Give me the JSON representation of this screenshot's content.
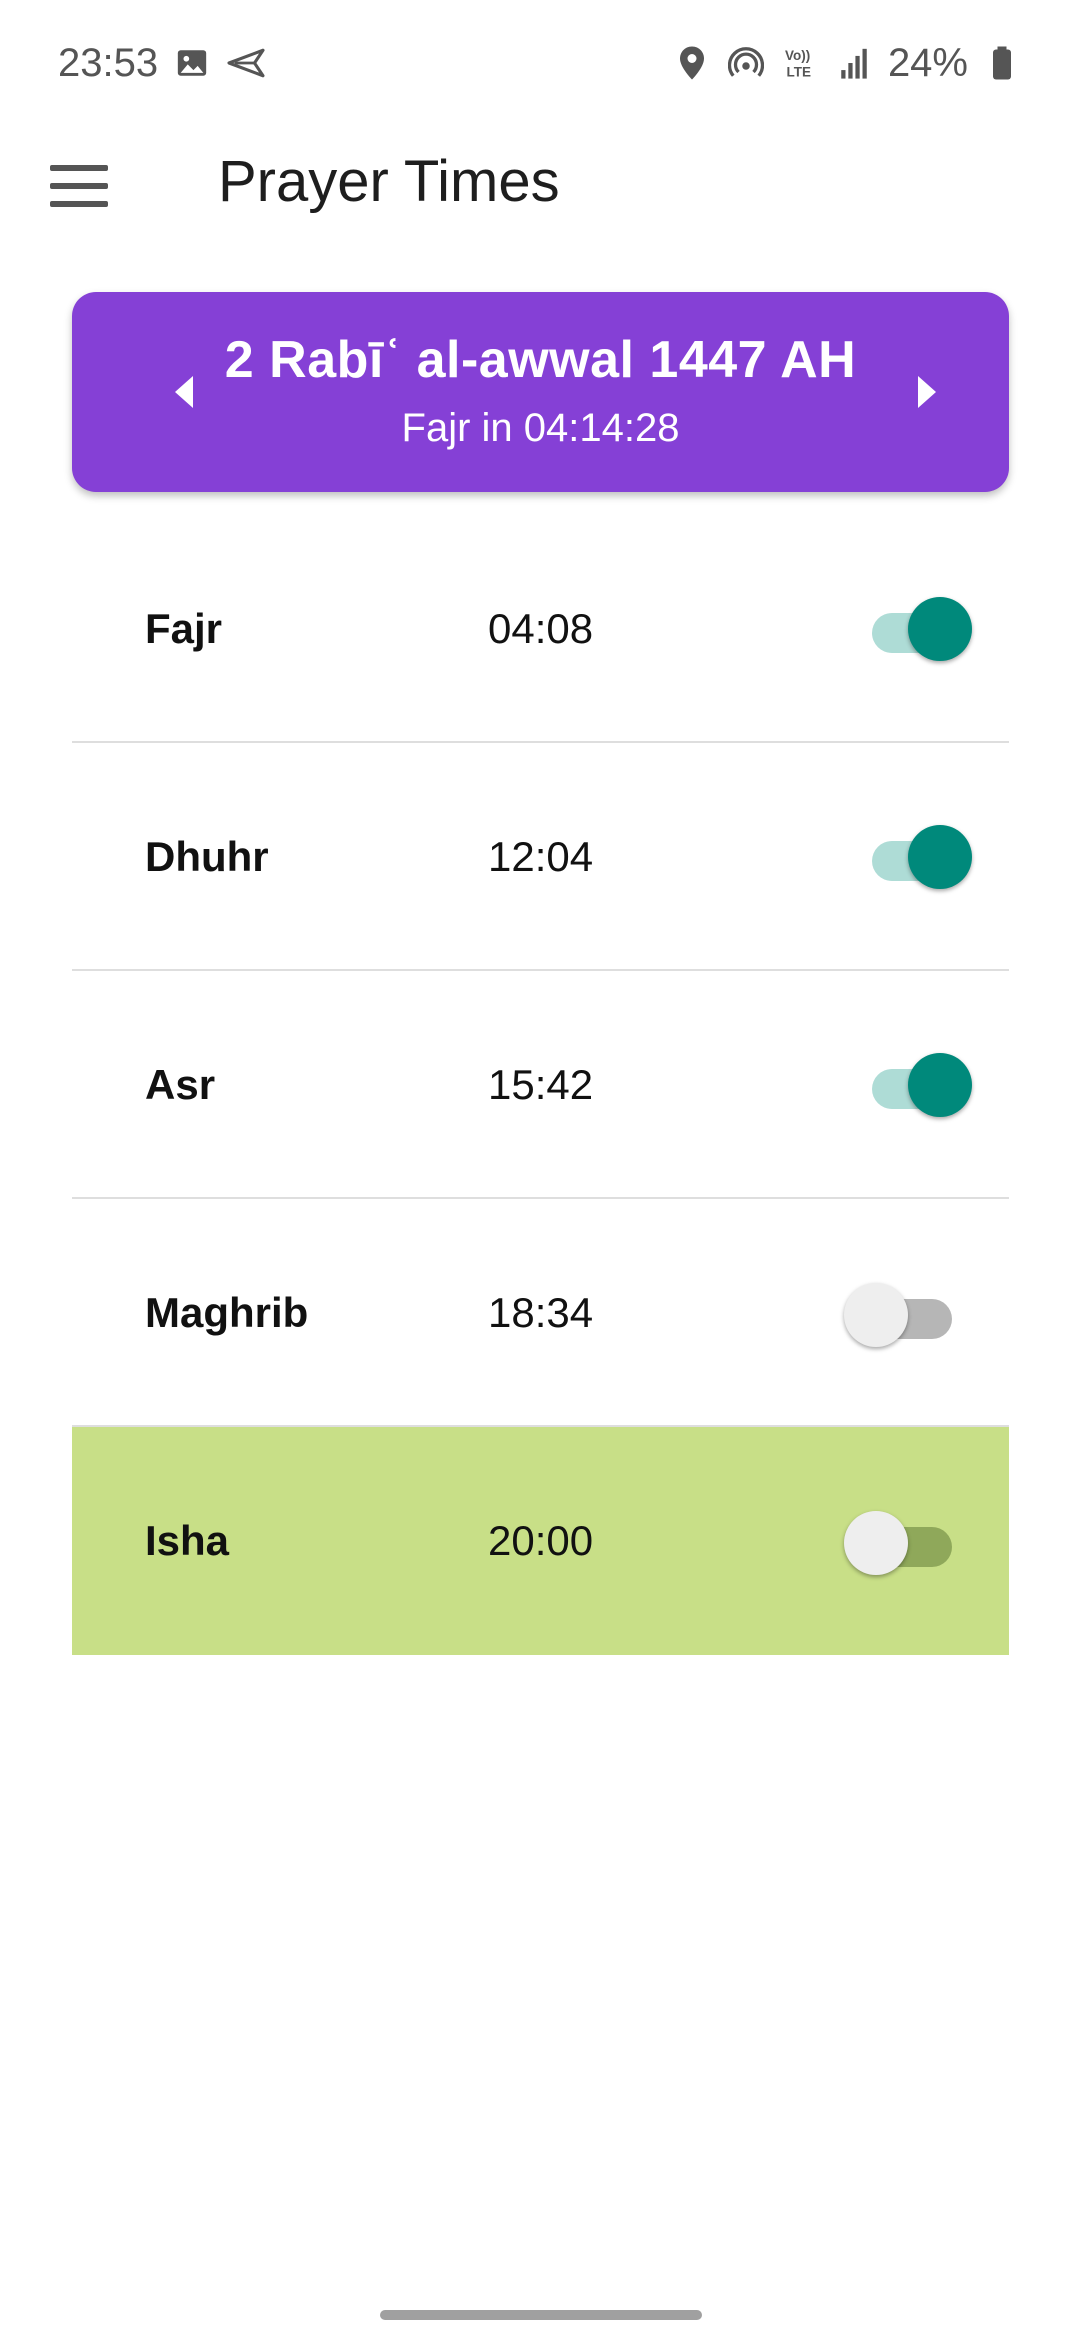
{
  "status_bar": {
    "time": "23:53",
    "battery": "24%",
    "icons_left": [
      "gallery-icon",
      "send-icon"
    ],
    "icons_right": [
      "location-icon",
      "hotspot-icon",
      "volte-icon",
      "signal-icon",
      "battery-icon"
    ]
  },
  "app_bar": {
    "title": "Prayer Times",
    "menu_icon": "hamburger-menu-icon"
  },
  "date_card": {
    "hijri_date": "2 Rabīʿ al-awwal 1447 AH",
    "countdown": "Fajr in 04:14:28",
    "background": "#8540d6"
  },
  "prayers": [
    {
      "name": "Fajr",
      "time": "04:08",
      "enabled": true
    },
    {
      "name": "Dhuhr",
      "time": "12:04",
      "enabled": true
    },
    {
      "name": "Asr",
      "time": "15:42",
      "enabled": true
    },
    {
      "name": "Maghrib",
      "time": "18:34",
      "enabled": false
    },
    {
      "name": "Isha",
      "time": "20:00",
      "enabled": false,
      "highlighted": true
    }
  ],
  "colors": {
    "accent": "#00897b",
    "highlight_row": "#c8df87"
  }
}
